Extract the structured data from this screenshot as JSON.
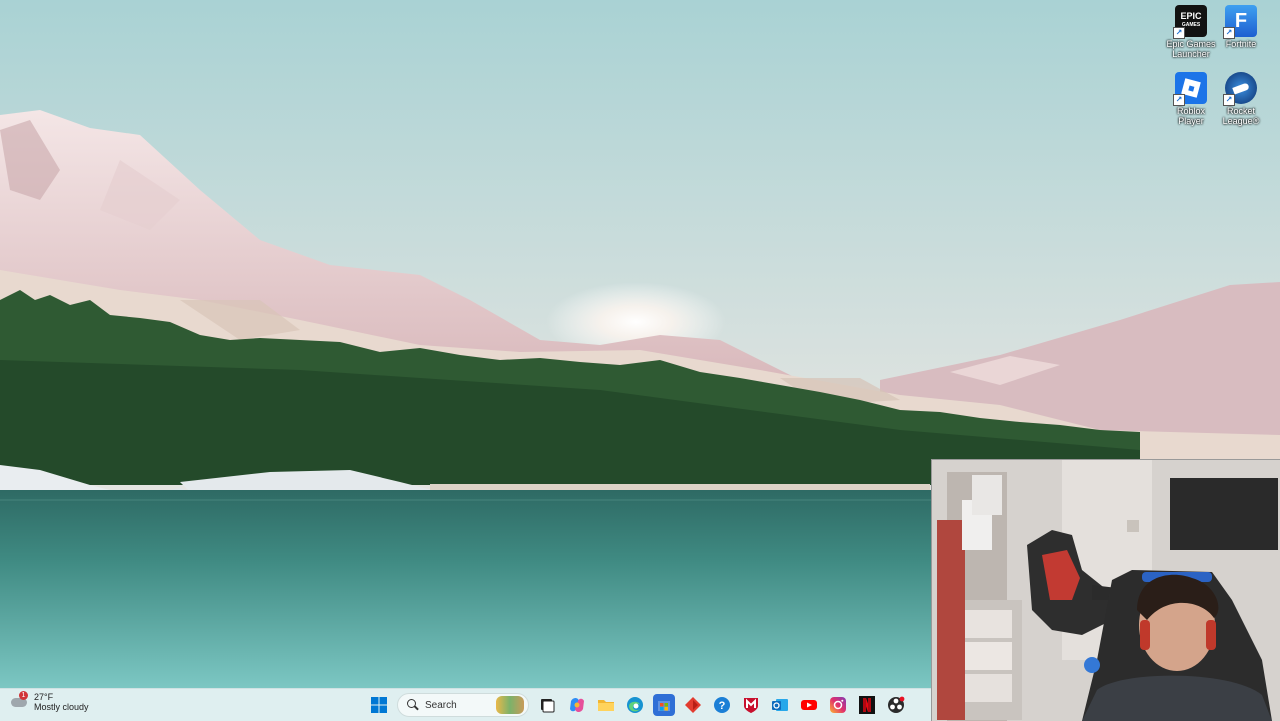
{
  "desktop": {
    "icons": [
      {
        "label": "Epic Games Launcher",
        "icon": "epic-games-icon",
        "mark": "EPIC",
        "sub": "GAMES"
      },
      {
        "label": "Fortnite",
        "icon": "fortnite-icon",
        "mark": "F"
      },
      {
        "label": "Roblox Player",
        "icon": "roblox-icon"
      },
      {
        "label": "Rocket League®",
        "icon": "rocket-league-icon"
      }
    ]
  },
  "taskbar": {
    "weather": {
      "temp": "27°F",
      "condition": "Mostly cloudy",
      "badge": "1"
    },
    "search": {
      "placeholder": "Search"
    },
    "pinned": [
      {
        "name": "start-button",
        "icon": "windows-logo-icon",
        "color": "#0067c0"
      },
      {
        "name": "task-view",
        "icon": "task-view-icon",
        "color": "#333333"
      },
      {
        "name": "copilot",
        "icon": "copilot-icon",
        "color": "#7a5af8"
      },
      {
        "name": "file-explorer",
        "icon": "folder-icon",
        "color": "#f2c14e"
      },
      {
        "name": "edge",
        "icon": "edge-icon",
        "color": "#1a8ccf"
      },
      {
        "name": "store",
        "icon": "store-icon",
        "color": "#2f6fd6"
      },
      {
        "name": "app-red-diamond",
        "icon": "red-diamond-icon",
        "color": "#e23c2f"
      },
      {
        "name": "help",
        "icon": "help-icon",
        "color": "#1b7fd6"
      },
      {
        "name": "mcafee",
        "icon": "mcafee-icon",
        "color": "#c8102e"
      },
      {
        "name": "outlook",
        "icon": "outlook-icon",
        "color": "#0f6cbd"
      },
      {
        "name": "youtube",
        "icon": "youtube-icon",
        "color": "#ff0000"
      },
      {
        "name": "instagram",
        "icon": "instagram-icon",
        "color": "#d6249f"
      },
      {
        "name": "netflix",
        "icon": "netflix-icon",
        "color": "#111111"
      },
      {
        "name": "obs",
        "icon": "obs-icon",
        "color": "#2b2b2b"
      }
    ]
  }
}
